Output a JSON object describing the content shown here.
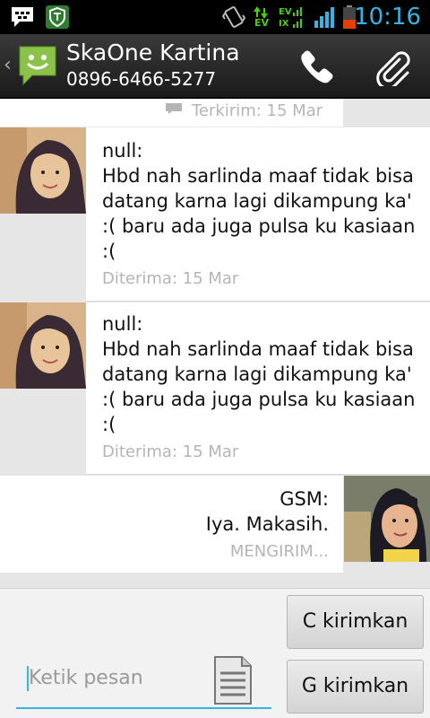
{
  "status_bar": {
    "time": "10:16",
    "ev_label_1": "EV",
    "ev_label_2": "EV",
    "ev_label_3": "IX"
  },
  "header": {
    "contact_name": "SkaOne Kartina",
    "phone_number": "0896-6466-5277"
  },
  "messages": [
    {
      "direction": "out",
      "body": "",
      "meta": "Terkirim: 15 Mar"
    },
    {
      "direction": "in",
      "sender": "null:",
      "body": "Hbd nah sarlinda maaf tidak bisa datang karna lagi dikampung ka' :( baru ada juga pulsa ku kasiaan :(",
      "meta": "Diterima: 15 Mar"
    },
    {
      "direction": "in",
      "sender": "null:",
      "body": "Hbd nah sarlinda maaf tidak bisa datang karna lagi dikampung ka' :( baru ada juga pulsa ku kasiaan :(",
      "meta": "Diterima: 15 Mar"
    },
    {
      "direction": "out",
      "sender": "GSM:",
      "body": "Iya. Makasih.",
      "meta": "MENGIRIM..."
    }
  ],
  "compose": {
    "placeholder": "Ketik pesan",
    "send_button_c": "C kirimkan",
    "send_button_g": "G kirimkan"
  },
  "colors": {
    "accent": "#33b5e5",
    "signal": "#4ad000",
    "battery": "#e53f00",
    "app_icon": "#8bc34a"
  }
}
